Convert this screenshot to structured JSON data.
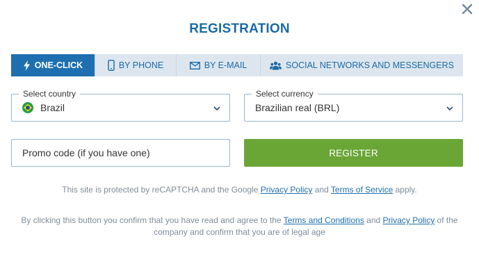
{
  "modal": {
    "title": "REGISTRATION",
    "close_icon": "close-icon"
  },
  "tabs": [
    {
      "label": "ONE-CLICK",
      "icon": "lightning-icon",
      "active": true
    },
    {
      "label": "BY PHONE",
      "icon": "phone-icon",
      "active": false
    },
    {
      "label": "BY E-MAIL",
      "icon": "envelope-icon",
      "active": false
    },
    {
      "label": "SOCIAL NETWORKS AND MESSENGERS",
      "icon": "users-icon",
      "active": false
    }
  ],
  "country": {
    "legend": "Select country",
    "value": "Brazil",
    "flag_icon": "brazil-flag-icon"
  },
  "currency": {
    "legend": "Select currency",
    "value": "Brazilian real (BRL)"
  },
  "promo": {
    "placeholder": "Promo code (if you have one)"
  },
  "register": {
    "label": "REGISTER"
  },
  "recaptcha_note": {
    "prefix": "This site is protected by reCAPTCHA and the Google ",
    "privacy_link": "Privacy Policy",
    "middle": " and ",
    "terms_link": "Terms of Service",
    "suffix": " apply."
  },
  "terms_note": {
    "prefix": "By clicking this button you confirm that you have read and agree to the ",
    "terms_link": "Terms and Conditions",
    "middle": " and ",
    "privacy_link": "Privacy Policy",
    "suffix": " of the company and confirm that you are of legal age"
  },
  "colors": {
    "accent": "#1d6fb0",
    "title": "#1b6aa5",
    "tab_inactive_bg": "#dde6ee",
    "register_green": "#6aa636",
    "field_border": "#9ab4c9",
    "muted_text": "#7e8c99"
  }
}
